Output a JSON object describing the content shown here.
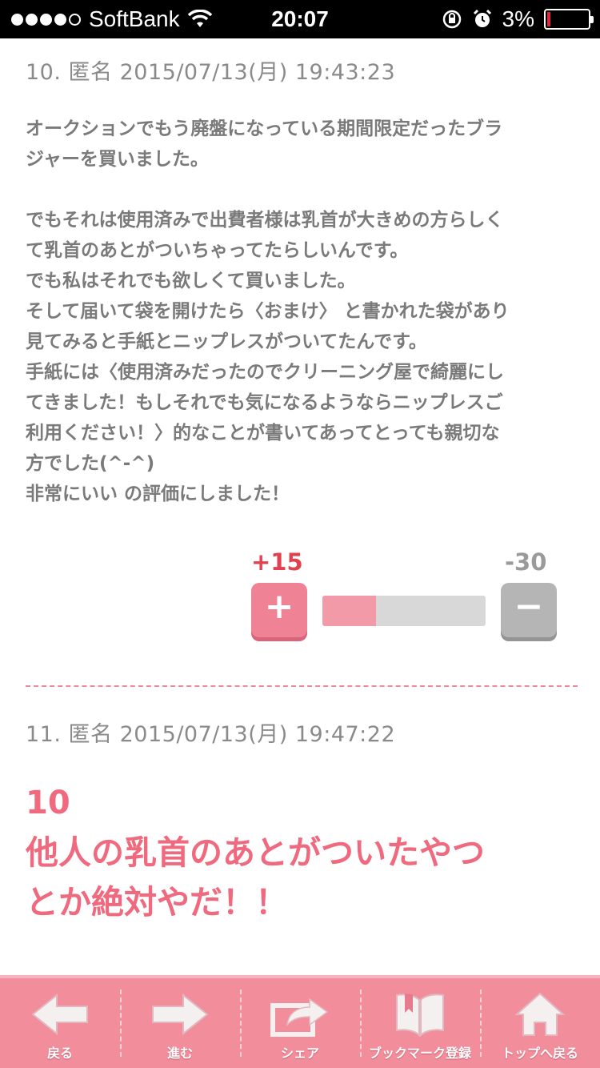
{
  "status_bar": {
    "carrier": "SoftBank",
    "time": "20:07",
    "battery": "3%"
  },
  "posts": [
    {
      "meta": "10. 匿名 2015/07/13(月) 19:43:23",
      "body": "オークションでもう廃盤になっている期間限定だったブラ\nジャーを買いました。\n\nでもそれは使用済みで出費者様は乳首が大きめの方らしく\nて乳首のあとがついちゃってたらしいんです。\nでも私はそれでも欲しくて買いました。\nそして届いて袋を開けたら〈おまけ〉 と書かれた袋があり\n見てみると手紙とニップレスがついてたんです。\n手紙には〈使用済みだったのでクリーニング屋で綺麗にし\nてきました！もしそれでも気になるようならニップレスご\n利用ください！〉的なことが書いてあってとっても親切な\n方でした(^-^)\n非常にいい の評価にしました！",
      "plus_count": "+15",
      "minus_count": "-30",
      "plus_symbol": "+",
      "minus_symbol": "−",
      "plus_ratio": 0.33
    },
    {
      "meta": "11. 匿名 2015/07/13(月) 19:47:22",
      "reply_ref": "10",
      "reply_line1": "他人の乳首のあとがついたやつ",
      "reply_line2": "とか絶対やだ！！"
    }
  ],
  "toolbar": [
    {
      "label": "戻る",
      "icon": "back-arrow-icon"
    },
    {
      "label": "進む",
      "icon": "forward-arrow-icon"
    },
    {
      "label": "シェア",
      "icon": "share-icon"
    },
    {
      "label": "ブックマーク登録",
      "icon": "bookmark-book-icon"
    },
    {
      "label": "トップへ戻る",
      "icon": "home-icon"
    }
  ],
  "colors": {
    "accent_pink": "#ef6a7e",
    "toolbar_pink": "#f28d9c",
    "minus_gray": "#b5b5b5"
  }
}
